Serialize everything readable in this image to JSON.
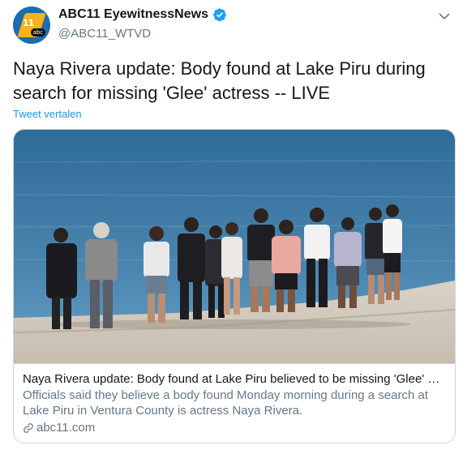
{
  "account": {
    "display_name": "ABC11 EyewitnessNews",
    "handle": "@ABC11_WTVD",
    "avatar_text": "11",
    "avatar_abc": "abc",
    "verified": true
  },
  "tweet": {
    "text": "Naya Rivera update: Body found at Lake Piru during search for missing 'Glee' actress -- LIVE",
    "translate_label": "Tweet vertalen"
  },
  "card": {
    "image_alt": "people-holding-hands-on-lake-shore",
    "title": "Naya Rivera update: Body found at Lake Piru believed to be missing 'Glee' actress",
    "description": "Officials said they believe a body found Monday morning during a search at Lake Piru in Ventura County is actress Naya Rivera.",
    "domain": "abc11.com"
  },
  "colors": {
    "link": "#1b95e0",
    "secondary_text": "#657786",
    "border": "#ccd6dd",
    "verified": "#1da1f2",
    "lake": "#3e7aa6",
    "shore": "#cfc6b8"
  }
}
